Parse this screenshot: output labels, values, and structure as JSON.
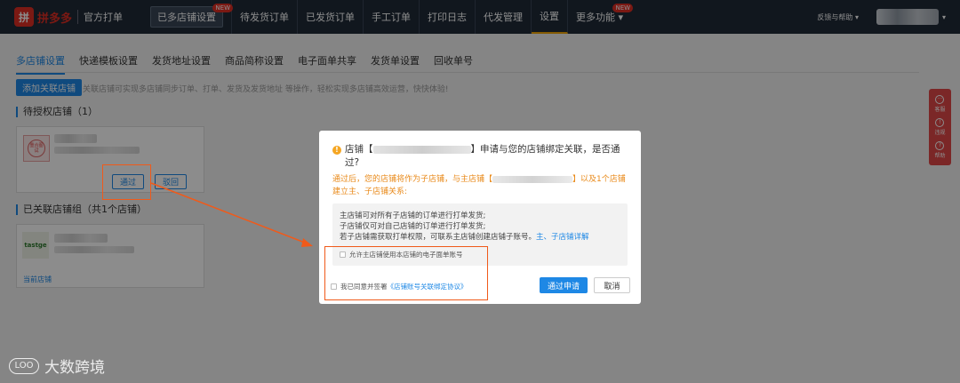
{
  "app": {
    "logo_glyph": "拼",
    "logo_text": "拼多多",
    "logo_sub": "官方打单"
  },
  "nav": {
    "items": [
      {
        "label": "已多店铺设置",
        "badge": "NEW"
      },
      {
        "label": "待发货订单"
      },
      {
        "label": "已发货订单"
      },
      {
        "label": "手工订单"
      },
      {
        "label": "打印日志"
      },
      {
        "label": "代发管理"
      },
      {
        "label": "设置"
      },
      {
        "label": "更多功能 ▾",
        "badge": "NEW"
      }
    ]
  },
  "topright": {
    "help": "反馈与帮助 ▾",
    "user_caret": "▾"
  },
  "tabs": [
    "多店铺设置",
    "快递模板设置",
    "发货地址设置",
    "商品简称设置",
    "电子面单共享",
    "发货单设置",
    "回收单号"
  ],
  "toolbar": {
    "add_label": "添加关联店铺",
    "hint": "关联店铺可实现多店铺同步订单、打单、发货及发货地址 等操作，轻松实现多店铺高效运营，快快体验!"
  },
  "pending": {
    "title": "待授权店铺（1）",
    "stamp_text": "重合图试",
    "approve_label": "通过",
    "reject_label": "驳回"
  },
  "linked": {
    "title": "已关联店铺组（共1个店铺）",
    "shop_logo": "tastge",
    "current_label": "当前店铺"
  },
  "side": {
    "items": [
      {
        "icon": "···",
        "label": "客服"
      },
      {
        "icon": "!",
        "label": "违规"
      },
      {
        "icon": "?",
        "label": "帮助"
      }
    ]
  },
  "modal": {
    "icon": "!",
    "title_prefix": "店铺【",
    "title_suffix": "】申请与您的店铺绑定关联，是否通过?",
    "warn_prefix": "通过后，您的店铺将作为子店铺，与主店铺【",
    "warn_suffix": "】以及1个店铺建立主、子店铺关系:",
    "info_lines": [
      "主店铺可对所有子店铺的订单进行打单发货;",
      "子店铺仅可对自己店铺的订单进行打单发货;",
      "若子店铺需获取打单权限，可联系主店铺创建店铺子账号。"
    ],
    "info_link": "主、子店铺详解",
    "allow_label": "允许主店铺使用本店铺的电子面单账号",
    "agree_prefix": "我已同意并签署",
    "agree_link": "《店铺账号关联绑定协议》",
    "confirm_label": "通过申请",
    "cancel_label": "取消"
  },
  "watermark": {
    "mark": "LOO",
    "text": "大数跨境"
  },
  "colors": {
    "topbar": "#1f2a38",
    "accent": "#1e88e5",
    "brand": "#e02e24",
    "warning": "#e98a1a",
    "annotation": "#f05a1a"
  }
}
